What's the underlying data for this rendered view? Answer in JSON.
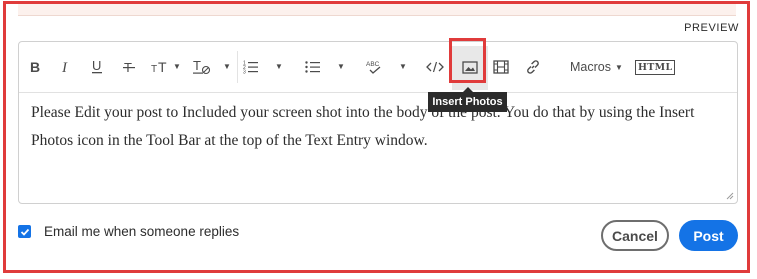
{
  "header": {
    "preview_label": "PREVIEW"
  },
  "toolbar": {
    "items": [
      {
        "name": "bold",
        "icon": "bold-icon"
      },
      {
        "name": "italic",
        "icon": "italic-icon"
      },
      {
        "name": "underline",
        "icon": "underline-icon"
      },
      {
        "name": "strikethrough",
        "icon": "strikethrough-icon"
      },
      {
        "name": "font-size",
        "icon": "text-size-icon"
      },
      {
        "name": "clear-format",
        "icon": "clear-format-icon"
      },
      {
        "name": "numbered-list",
        "icon": "numbered-list-icon"
      },
      {
        "name": "bullet-list",
        "icon": "bullet-list-icon"
      },
      {
        "name": "spellcheck",
        "icon": "spellcheck-icon"
      },
      {
        "name": "code",
        "icon": "code-icon"
      },
      {
        "name": "insert-photos",
        "icon": "image-icon"
      },
      {
        "name": "insert-video",
        "icon": "film-icon"
      },
      {
        "name": "insert-link",
        "icon": "link-icon"
      }
    ],
    "macros_label": "Macros",
    "html_label": "HTML",
    "tooltip_text": "Insert Photos"
  },
  "editor": {
    "body_text": "Please Edit your post to Included your screen shot into the body of the post. You do that by using the Insert Photos icon in the Tool Bar at the top of the Text Entry window."
  },
  "footer": {
    "email_checkbox_label": "Email me when someone replies",
    "email_checkbox_checked": true,
    "cancel_label": "Cancel",
    "post_label": "Post"
  },
  "colors": {
    "accent": "#1473e6",
    "highlight": "#e03b3b",
    "tooltip_bg": "#2b2b2b"
  }
}
